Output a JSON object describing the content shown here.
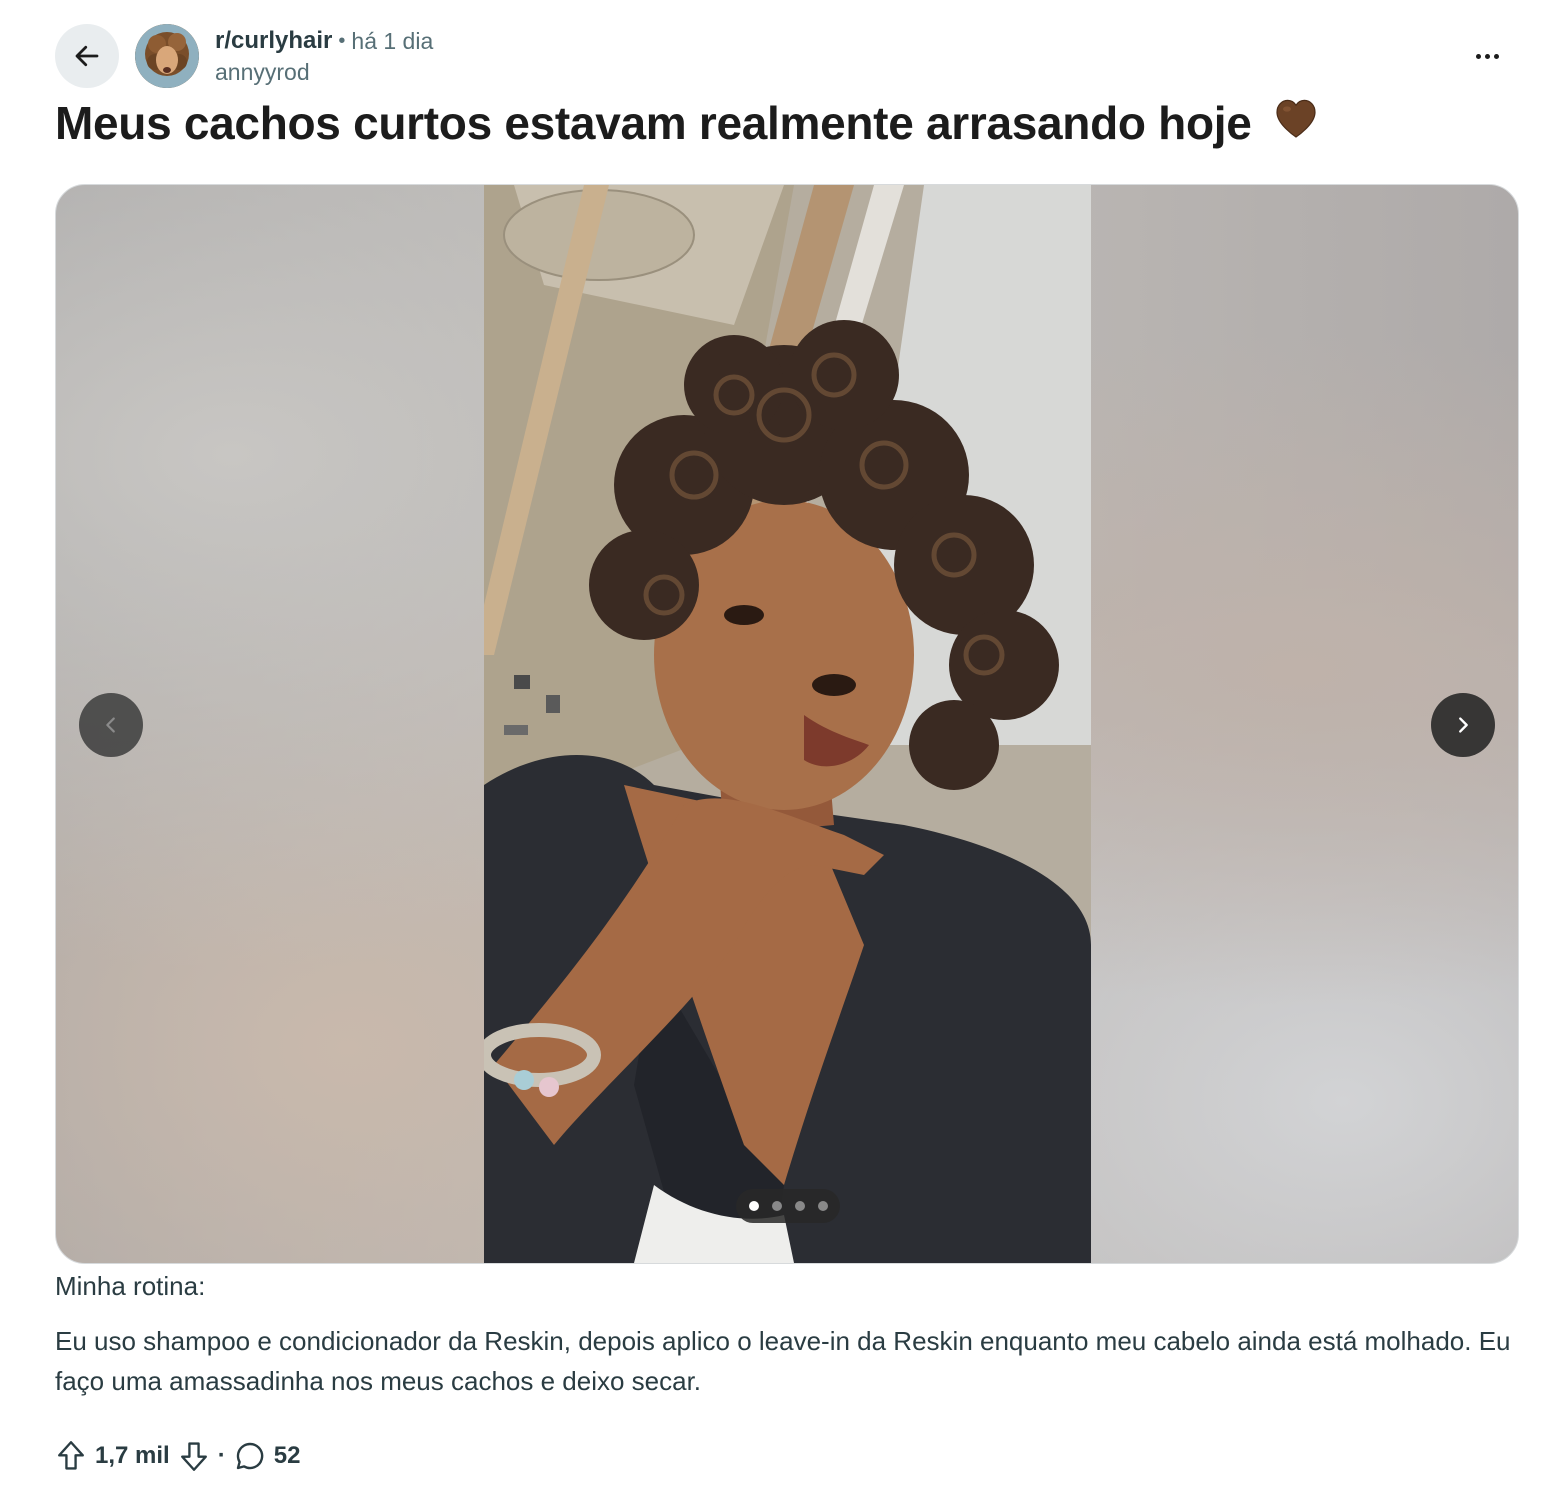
{
  "header": {
    "subreddit": "r/curlyhair",
    "separator": "•",
    "time": "há 1 dia",
    "username": "annyyrod"
  },
  "post": {
    "title": "Meus cachos curtos estavam realmente arrasando hoje",
    "title_emoji": "brown-heart",
    "body": [
      "Minha rotina:",
      "Eu uso shampoo e condicionador da Reskin, depois aplico o leave-in da Reskin enquanto meu cabelo ainda está molhado. Eu faço uma amassadinha nos meus cachos e deixo secar."
    ]
  },
  "gallery": {
    "total_images": 4,
    "current_index": 1
  },
  "actions": {
    "upvotes": "1,7 mil",
    "separator": "·",
    "comments": "52"
  },
  "colors": {
    "meta_gray": "#576f76",
    "text_dark": "#1c1c1c",
    "body_text": "#2a3c42",
    "heart_brown": "#6b4226"
  },
  "icons": {
    "back": "arrow-left-icon",
    "more": "more-horizontal-icon",
    "prev": "chevron-left-icon",
    "next": "chevron-right-icon",
    "upvote": "arrow-up-outline-icon",
    "downvote": "arrow-down-outline-icon",
    "comment": "speech-bubble-icon"
  }
}
